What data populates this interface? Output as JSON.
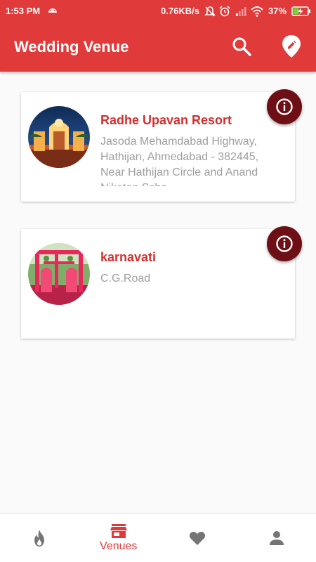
{
  "status_bar": {
    "time": "1:53 PM",
    "network_speed": "0.76KB/s",
    "battery_percent": "37%"
  },
  "app_bar": {
    "title": "Wedding Venue",
    "actions": [
      "search-icon",
      "location-edit-icon"
    ]
  },
  "venues": [
    {
      "name": "Radhe Upavan Resort",
      "address": "Jasoda Mehamdabad Highway, Hathijan, Ahmedabad - 382445, Near Hathijan Circle and Anand Niketan Scho"
    },
    {
      "name": "karnavati",
      "address": "C.G.Road"
    }
  ],
  "bottom_nav": {
    "items": [
      {
        "icon": "flame-icon",
        "label": ""
      },
      {
        "icon": "store-icon",
        "label": "Venues",
        "active": true
      },
      {
        "icon": "heart-icon",
        "label": ""
      },
      {
        "icon": "person-icon",
        "label": ""
      }
    ]
  },
  "colors": {
    "primary": "#e03a3a",
    "venue_name": "#d32f2f",
    "info_button": "#6d0f14",
    "nav_inactive": "#757575"
  }
}
